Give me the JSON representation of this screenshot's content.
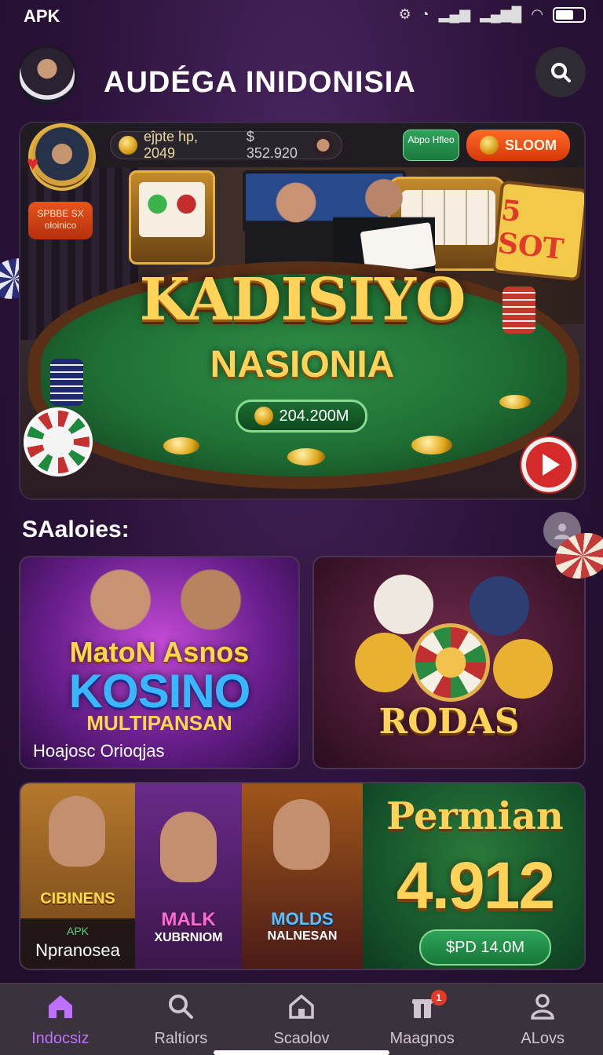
{
  "status_bar": {
    "carrier": "APK"
  },
  "header": {
    "title": "AUDÉGA INIDONISIA"
  },
  "hero": {
    "balance_label": "eĵpte hp, 2049",
    "balance_value": "$ 352.920",
    "promo_green": "Abpo Hfleo",
    "promo_orange": "SLOOM",
    "speed_tag": "SPBBE SX oloinico",
    "slot_sign": "5 SOT",
    "title": "KADISIYO",
    "subtitle": "NASIONIA",
    "jackpot": "204.200M"
  },
  "section": {
    "title": "SAaloies:"
  },
  "cards": {
    "kosino": {
      "top": "MatoN Asnos",
      "main": "KOSINO",
      "sub": "MULTIPANSAN",
      "caption": "Hoajosc Orioqjas"
    },
    "rodas": {
      "title": "RODAS"
    },
    "bottom": {
      "thumb1_banner": "CIBINENS",
      "thumb1_tag": "APK",
      "thumb1_caption": "Npranosea",
      "thumb2_banner": "MALK",
      "thumb2_sub": "XUBRNIOM",
      "thumb3_banner": "MOLDS",
      "thumb3_sub": "NALNESAN",
      "permian_title": "Permian",
      "permian_value": "4.912",
      "permian_button": "$PD 14.0M"
    }
  },
  "bottom_nav": {
    "items": [
      {
        "label": "Indocsiz",
        "icon": "home-icon",
        "active": true
      },
      {
        "label": "Raltiors",
        "icon": "search-icon",
        "active": false
      },
      {
        "label": "Scaolov",
        "icon": "house-outline-icon",
        "active": false
      },
      {
        "label": "Maagnos",
        "icon": "gift-icon",
        "active": false,
        "badge": "1"
      },
      {
        "label": "ALovs",
        "icon": "person-icon",
        "active": false
      }
    ]
  },
  "colors": {
    "accent_purple": "#c070ff",
    "gold": "#ffd35a",
    "green": "#1f6f34",
    "orange": "#e8541c"
  }
}
